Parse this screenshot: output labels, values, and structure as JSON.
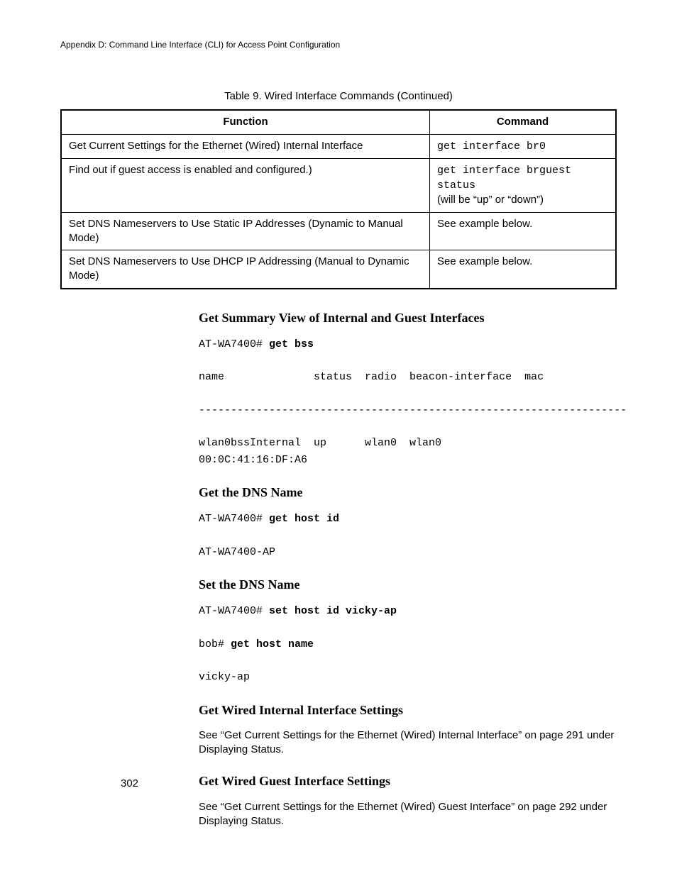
{
  "header": "Appendix D: Command Line Interface (CLI) for Access Point Configuration",
  "table": {
    "caption": "Table 9. Wired Interface Commands (Continued)",
    "headers": {
      "func": "Function",
      "cmd": "Command"
    },
    "rows": [
      {
        "func": "Get Current Settings for the Ethernet (Wired) Internal Interface",
        "cmd_code": "get interface br0",
        "cmd_note": ""
      },
      {
        "func": "Find out if guest access is enabled and configured.)",
        "cmd_code": "get interface brguest status",
        "cmd_note": "(will be “up” or “down”)"
      },
      {
        "func": "Set DNS Nameservers to Use Static IP Addresses (Dynamic to Manual Mode)",
        "cmd_code": "",
        "cmd_note": "See example below."
      },
      {
        "func": "Set DNS Nameservers to Use DHCP IP Addressing (Manual to Dynamic Mode)",
        "cmd_code": "",
        "cmd_note": "See example below."
      }
    ]
  },
  "sections": {
    "s1": {
      "title": "Get Summary View of Internal and Guest Interfaces",
      "prompt1": "AT-WA7400# ",
      "cmd1": "get bss",
      "output1": "name              status  radio  beacon-interface  mac",
      "sep": "-------------------------------------------------------------------",
      "output2": "wlan0bssInternal  up      wlan0  wlan0             \n00:0C:41:16:DF:A6"
    },
    "s2": {
      "title": "Get the DNS Name",
      "prompt1": "AT-WA7400# ",
      "cmd1": "get host id",
      "output1": "AT-WA7400-AP"
    },
    "s3": {
      "title": "Set the DNS Name",
      "prompt1": "AT-WA7400# ",
      "cmd1": "set host id vicky-ap",
      "prompt2": "bob# ",
      "cmd2": "get host name",
      "output1": "vicky-ap"
    },
    "s4": {
      "title": "Get Wired Internal Interface Settings",
      "body": "See “Get Current Settings for the Ethernet (Wired) Internal Interface” on page 291 under Displaying Status."
    },
    "s5": {
      "title": "Get Wired Guest Interface Settings",
      "body": "See “Get Current Settings for the Ethernet (Wired) Guest Interface” on page 292 under Displaying Status."
    }
  },
  "page_number": "302"
}
